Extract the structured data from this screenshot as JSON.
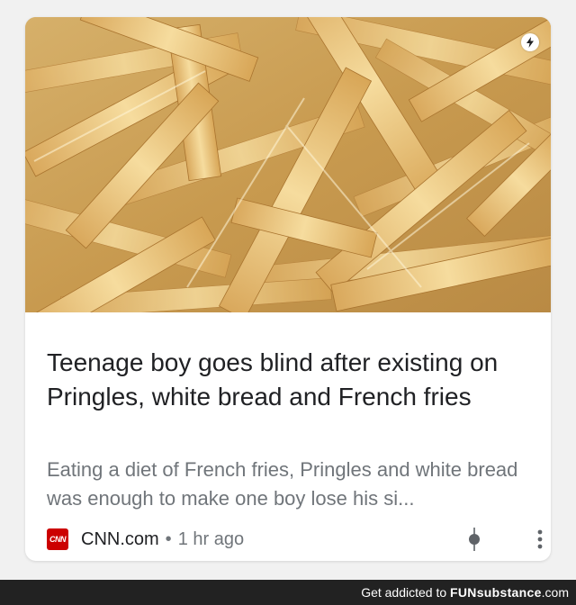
{
  "card": {
    "image_alt": "French fries photo",
    "headline": "Teenage boy goes blind after existing on Pringles, white bread and French fries",
    "snippet": "Eating a diet of French fries, Pringles and white bread was enough to make one boy lose his si...",
    "source": {
      "logo_text": "CNN",
      "name": "CNN.com",
      "separator": "•",
      "time": "1 hr ago"
    },
    "icons": {
      "amp": "lightning-bolt-icon",
      "interest": "interest-control-icon",
      "menu": "more-vertical-icon"
    }
  },
  "footer": {
    "prefix": "Get addicted to ",
    "brand": "FUNsubstance",
    "suffix": ".com"
  },
  "colors": {
    "background": "#f1f1f1",
    "card": "#ffffff",
    "headline": "#202124",
    "secondary": "#70757a",
    "cnn_red": "#cc0000",
    "footer_bar": "#222222"
  }
}
